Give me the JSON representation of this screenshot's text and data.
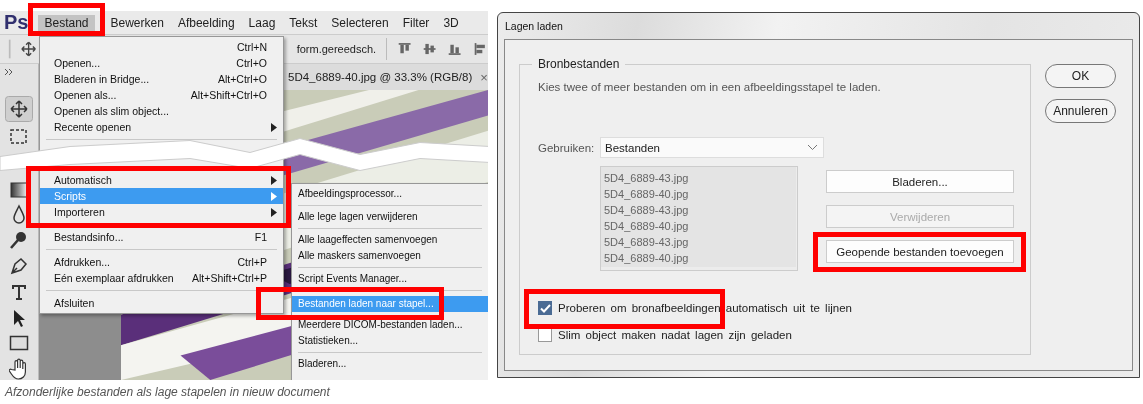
{
  "app_menu": {
    "logo": "Ps",
    "items": [
      {
        "label": "Bestand",
        "selected": true
      },
      {
        "label": "Bewerken",
        "selected": false
      },
      {
        "label": "Afbeelding",
        "selected": false
      },
      {
        "label": "Laag",
        "selected": false
      },
      {
        "label": "Tekst",
        "selected": false
      },
      {
        "label": "Selecteren",
        "selected": false
      },
      {
        "label": "Filter",
        "selected": false
      },
      {
        "label": "3D",
        "selected": false
      }
    ]
  },
  "options_bar": {
    "label": "form.gereedsch."
  },
  "document_tab": {
    "title": "5D4_6889-40.jpg @ 33.3% (RGB/8)",
    "close": "×"
  },
  "file_menu": [
    {
      "kind": "item",
      "shortcut": "Ctrl+N",
      "submenu": false,
      "selected": false
    },
    {
      "kind": "item",
      "label": "Openen...",
      "shortcut": "Ctrl+O",
      "submenu": false,
      "selected": false
    },
    {
      "kind": "item",
      "label": "Bladeren in Bridge...",
      "shortcut": "Alt+Ctrl+O",
      "submenu": false,
      "selected": false
    },
    {
      "kind": "item",
      "label": "Openen als...",
      "shortcut": "Alt+Shift+Ctrl+O",
      "submenu": false,
      "selected": false
    },
    {
      "kind": "item",
      "label": "Openen als slim object...",
      "submenu": false,
      "selected": false
    },
    {
      "kind": "item",
      "label": "Recente openen",
      "submenu": true,
      "selected": false
    },
    {
      "kind": "separator"
    },
    {
      "kind": "tear"
    },
    {
      "kind": "item",
      "label": "Automatisch",
      "submenu": true,
      "selected": false
    },
    {
      "kind": "item",
      "label": "Scripts",
      "submenu": true,
      "selected": true
    },
    {
      "kind": "item",
      "label": "Importeren",
      "submenu": true,
      "selected": false
    },
    {
      "kind": "separator"
    },
    {
      "kind": "item",
      "label": "Bestandsinfo...",
      "shortcut": "F1",
      "submenu": false,
      "selected": false
    },
    {
      "kind": "separator"
    },
    {
      "kind": "item",
      "label": "Afdrukken...",
      "shortcut": "Ctrl+P",
      "submenu": false,
      "selected": false
    },
    {
      "kind": "item",
      "label": "Eén exemplaar afdrukken",
      "shortcut": "Alt+Shift+Ctrl+P",
      "submenu": false,
      "selected": false
    },
    {
      "kind": "separator"
    },
    {
      "kind": "item",
      "label": "Afsluiten",
      "submenu": false,
      "selected": false
    }
  ],
  "scripts_menu": [
    {
      "kind": "item",
      "label": "Afbeeldingsprocessor...",
      "selected": false
    },
    {
      "kind": "separator"
    },
    {
      "kind": "item",
      "label": "Alle lege lagen verwijderen",
      "selected": false
    },
    {
      "kind": "separator"
    },
    {
      "kind": "item",
      "label": "Alle laageffecten samenvoegen",
      "selected": false
    },
    {
      "kind": "item",
      "label": "Alle maskers samenvoegen",
      "selected": false
    },
    {
      "kind": "separator"
    },
    {
      "kind": "item",
      "label": "Script Events Manager...",
      "selected": false
    },
    {
      "kind": "separator"
    },
    {
      "kind": "item",
      "label": "Bestanden laden naar stapel...",
      "selected": true
    },
    {
      "kind": "item",
      "label": "Meerdere DICOM-bestanden laden...",
      "selected": false
    },
    {
      "kind": "item",
      "label": "Statistieken...",
      "selected": false
    },
    {
      "kind": "separator"
    },
    {
      "kind": "item",
      "label": "Bladeren...",
      "selected": false
    }
  ],
  "caption": "Afzonderlijke bestanden als lage stapelen in nieuw document",
  "dialog": {
    "title": "Lagen laden",
    "group": {
      "legend": "Bronbestanden",
      "description": "Kies twee of meer bestanden om in een afbeeldingsstapel te laden.",
      "use_label": "Gebruiken:",
      "use_value": "Bestanden",
      "files": [
        "5D4_6889-43.jpg",
        "5D4_6889-40.jpg",
        "5D4_6889-43.jpg",
        "5D4_6889-40.jpg",
        "5D4_6889-43.jpg",
        "5D4_6889-40.jpg"
      ],
      "buttons": [
        {
          "label": "Bladeren...",
          "disabled": false
        },
        {
          "label": "Verwijderen",
          "disabled": true
        },
        {
          "label": "Geopende bestanden toevoegen",
          "disabled": false
        }
      ],
      "options": [
        {
          "label": "Proberen om bronafbeeldingen automatisch uit te lijnen",
          "checked": true
        },
        {
          "label": "Slim object maken nadat lagen zijn geladen",
          "checked": false
        }
      ]
    },
    "actions": [
      {
        "label": "OK"
      },
      {
        "label": "Annuleren"
      }
    ]
  }
}
